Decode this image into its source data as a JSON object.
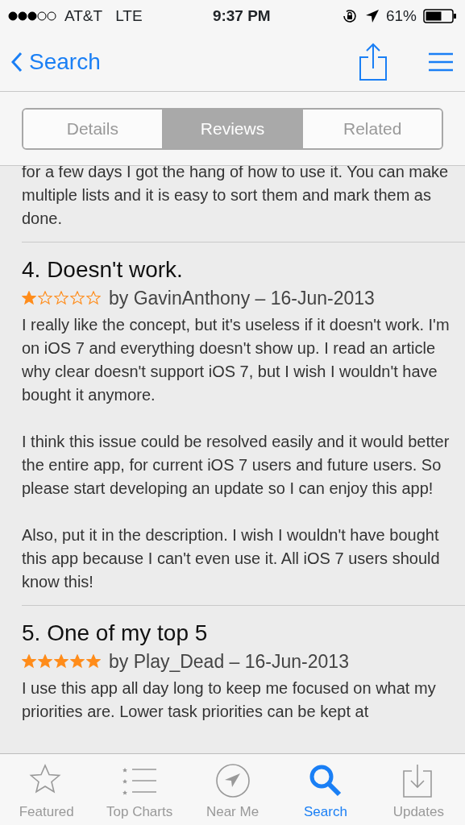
{
  "status_bar": {
    "carrier": "AT&T",
    "network": "LTE",
    "time": "9:37 PM",
    "battery": "61%"
  },
  "nav": {
    "back": "Search"
  },
  "segments": [
    {
      "label": "Details",
      "selected": false
    },
    {
      "label": "Reviews",
      "selected": true
    },
    {
      "label": "Related",
      "selected": false
    }
  ],
  "reviews": [
    {
      "kind": "continuation",
      "paragraphs": [
        "for a few days I got the hang of how to use it. You can make multiple lists and it is easy to sort them and mark them as done."
      ]
    },
    {
      "kind": "review",
      "title": "4. Doesn't work.",
      "stars": 1,
      "byline": "by GavinAnthony – 16-Jun-2013",
      "paragraphs": [
        "I really like the concept, but it's useless if it doesn't work. I'm on iOS 7 and everything doesn't show up. I read an article why clear doesn't support iOS 7, but I wish I wouldn't have bought it anymore.",
        "I think this issue could be resolved easily and it would better the entire app, for current iOS 7 users and future users. So please start developing an update so I can enjoy this app!",
        "Also, put it in the description. I wish I wouldn't have bought this app because I can't even use it. All iOS 7 users should know this!"
      ]
    },
    {
      "kind": "review",
      "title": "5. One of my top 5",
      "stars": 5,
      "byline": "by Play_Dead – 16-Jun-2013",
      "paragraphs": [
        "I use this app all day long to keep me focused on what my priorities are. Lower task priorities can be kept at"
      ]
    }
  ],
  "tab_bar": [
    {
      "label": "Featured",
      "selected": false
    },
    {
      "label": "Top Charts",
      "selected": false
    },
    {
      "label": "Near Me",
      "selected": false
    },
    {
      "label": "Search",
      "selected": true
    },
    {
      "label": "Updates",
      "selected": false
    }
  ]
}
